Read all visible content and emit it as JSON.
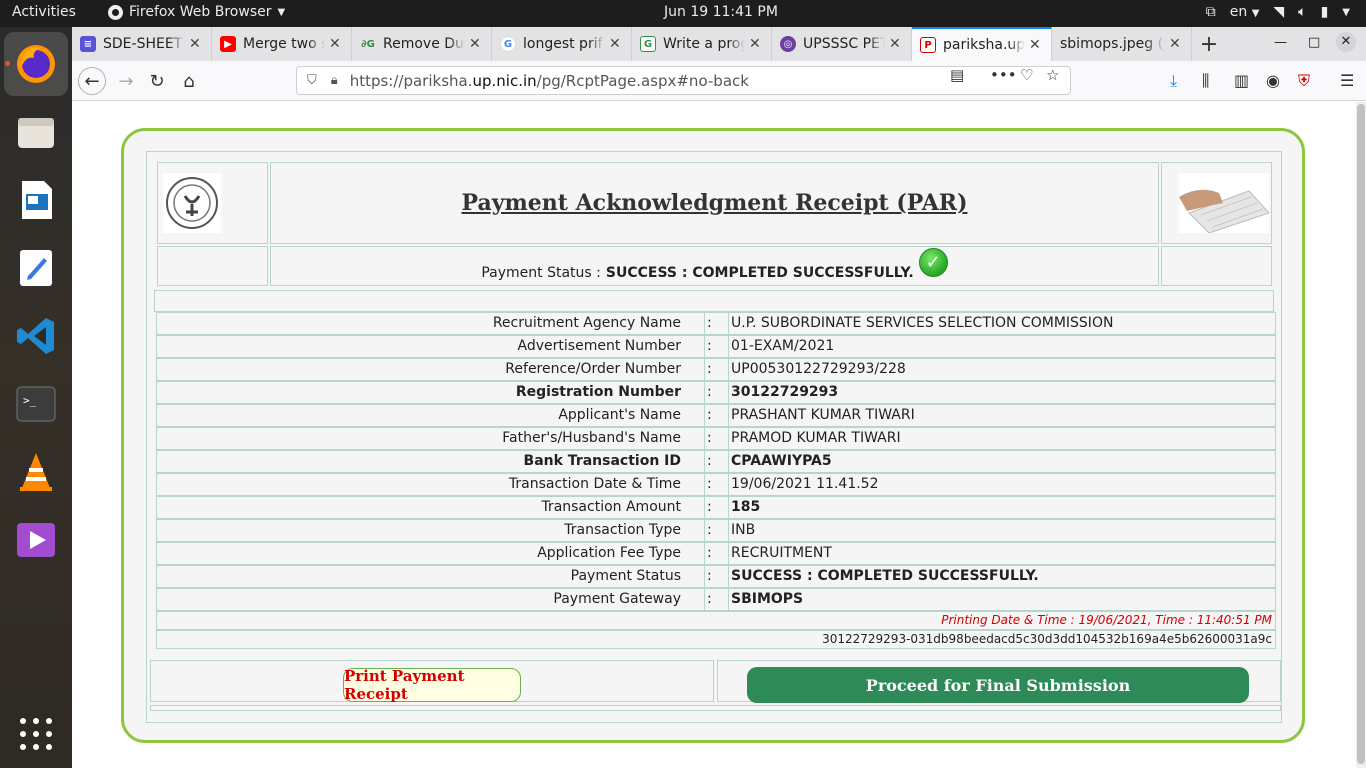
{
  "topbar": {
    "activities": "Activities",
    "app_menu": "Firefox Web Browser",
    "clock": "Jun 19  11:41 PM",
    "lang": "en"
  },
  "tabs": [
    {
      "title": "SDE-SHEET",
      "favicon_color": "#5b53d6"
    },
    {
      "title": "Merge two s",
      "favicon_color": "#ff0000"
    },
    {
      "title": "Remove Dup",
      "favicon_color": "#2f8d46"
    },
    {
      "title": "longest prif",
      "favicon_color": "#4285f4"
    },
    {
      "title": "Write a prog",
      "favicon_color": "#2f8d46"
    },
    {
      "title": "UPSSSC PET",
      "favicon_color": "#6a3fa0"
    },
    {
      "title": "pariksha.up",
      "favicon_color": "#d40000",
      "active": true
    },
    {
      "title": "sbimops.jpeg (J",
      "favicon_color": ""
    }
  ],
  "url": {
    "prefix": "https://pariksha.",
    "domain": "up.nic.in",
    "path": "/pg/RcptPage.aspx#no-back"
  },
  "receipt": {
    "title": "Payment Acknowledgment Receipt (PAR)",
    "status_label": "Payment Status :",
    "status_value": "SUCCESS : COMPLETED SUCCESSFULLY.",
    "fields": [
      {
        "label": "Recruitment Agency Name",
        "value": "U.P. SUBORDINATE SERVICES SELECTION COMMISSION",
        "bold": false
      },
      {
        "label": "Advertisement Number",
        "value": "01-EXAM/2021",
        "bold": false
      },
      {
        "label": "Reference/Order Number",
        "value": "UP00530122729293/228",
        "bold": false
      },
      {
        "label": "Registration Number",
        "value": "30122729293",
        "bold": true
      },
      {
        "label": "Applicant's Name",
        "value": "PRASHANT KUMAR TIWARI",
        "bold": false
      },
      {
        "label": "Father's/Husband's Name",
        "value": "PRAMOD KUMAR TIWARI",
        "bold": false
      },
      {
        "label": "Bank Transaction ID",
        "value": "CPAAWIYPA5",
        "bold": true
      },
      {
        "label": "Transaction Date & Time",
        "value": "19/06/2021 11.41.52",
        "bold": false
      },
      {
        "label": "Transaction Amount",
        "value": "185",
        "bold": true,
        "label_bold": false
      },
      {
        "label": "Transaction Type",
        "value": "INB",
        "bold": false
      },
      {
        "label": "Application Fee Type",
        "value": "RECRUITMENT",
        "bold": false
      },
      {
        "label": "Payment Status",
        "value": "SUCCESS : COMPLETED SUCCESSFULLY.",
        "bold": true,
        "label_bold": false
      },
      {
        "label": "Payment Gateway",
        "value": "SBIMOPS",
        "bold": true,
        "label_bold": false
      }
    ],
    "colon": ":",
    "printing_time": "Printing Date & Time : 19/06/2021, Time : 11:40:51 PM",
    "hash": "30122729293-031db98beedacd5c30d3dd104532b169a4e5b62600031a9c",
    "print_button": "Print Payment Receipt",
    "final_button": "Proceed for Final Submission"
  }
}
